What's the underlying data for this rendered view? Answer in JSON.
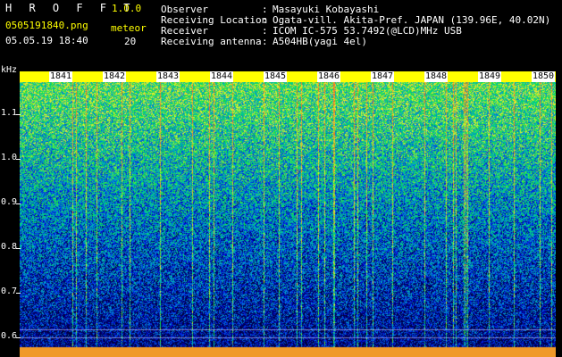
{
  "header": {
    "app_name": "H R O F F T",
    "version": "1.0.0",
    "filename": "0505191840.png",
    "timestamp": "05.05.19 18:40",
    "meteor_label": "meteor",
    "meteor_count": "20"
  },
  "info": [
    {
      "key": "Observer",
      "value": "Masayuki Kobayashi"
    },
    {
      "key": "Receiving Location",
      "value": "Ogata-vill. Akita-Pref. JAPAN (139.96E, 40.02N)"
    },
    {
      "key": "Receiver",
      "value": "ICOM IC-575 53.7492(@LCD)MHz USB"
    },
    {
      "key": "Receiving antenna",
      "value": "A504HB(yagi 4el)"
    }
  ],
  "axis": {
    "unit": "kHz",
    "y_labels": [
      "1.1",
      "1.0",
      "0.9",
      "0.8",
      "0.7",
      "0.6"
    ],
    "x_labels": [
      "1841",
      "1842",
      "1843",
      "1844",
      "1845",
      "1846",
      "1847",
      "1848",
      "1849",
      "1850"
    ]
  },
  "colors": {
    "background": "#000000",
    "time_bar": "#ffff00",
    "label_yellow": "#ffff00"
  }
}
